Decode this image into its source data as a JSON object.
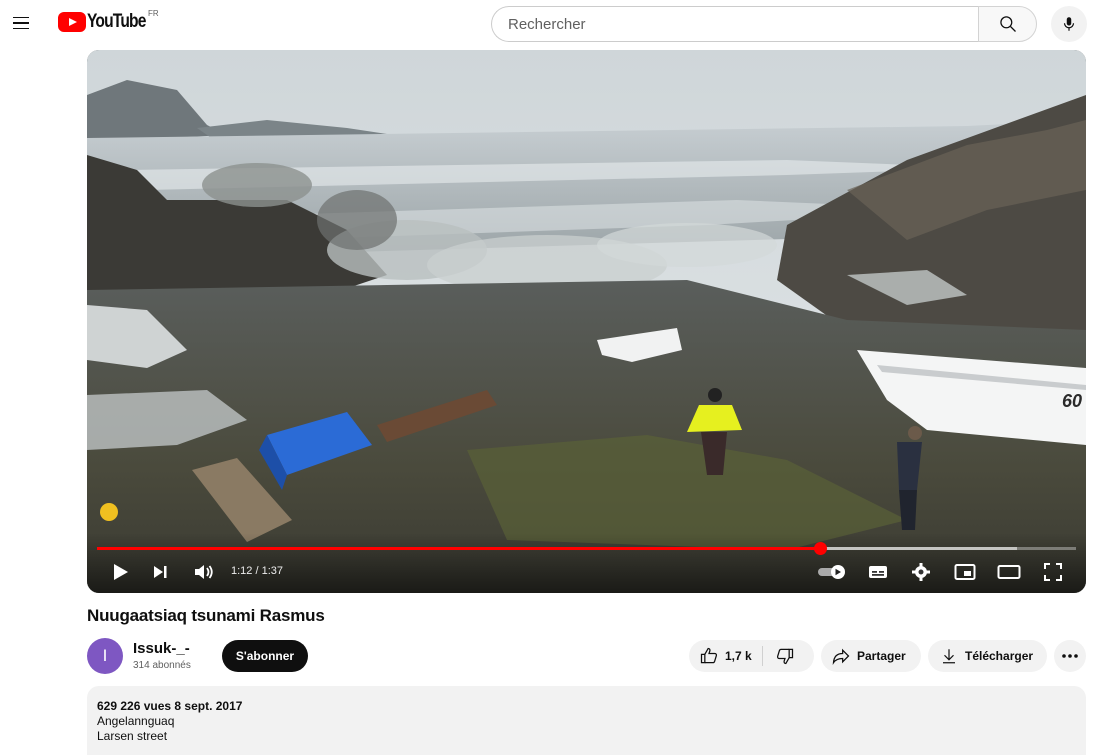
{
  "header": {
    "logo_text": "YouTube",
    "region": "FR",
    "search_placeholder": "Rechercher"
  },
  "player": {
    "time_current": "1:12",
    "time_total": "1:37",
    "time_display": "1:12 / 1:37",
    "progress_fraction": 0.738,
    "buffer_fraction": 0.94,
    "overlay_boat_number": "60"
  },
  "video": {
    "title": "Nuugaatsiaq tsunami Rasmus"
  },
  "channel": {
    "avatar_letter": "I",
    "name": "Issuk-_-",
    "subscribers": "314 abonnés",
    "subscribe_label": "S'abonner"
  },
  "actions": {
    "likes": "1,7 k",
    "share_label": "Partager",
    "download_label": "Télécharger"
  },
  "description": {
    "meta": "629 226 vues  8 sept. 2017",
    "lines": [
      "Angelannguaq",
      "Larsen street"
    ]
  },
  "colors": {
    "brand_red": "#ff0000",
    "progress_red": "#ff0000",
    "avatar": "#7e57c2"
  }
}
